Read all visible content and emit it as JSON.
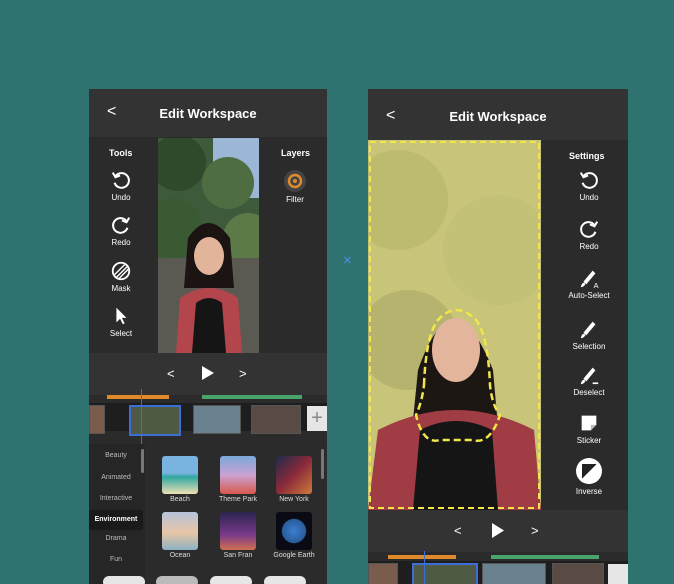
{
  "left_screen": {
    "title": "Edit Workspace",
    "back_glyph": "<",
    "tools_header": "Tools",
    "layers_header": "Layers",
    "tools": [
      {
        "label": "Undo",
        "icon": "undo-icon"
      },
      {
        "label": "Redo",
        "icon": "redo-icon"
      },
      {
        "label": "Mask",
        "icon": "mask-icon"
      },
      {
        "label": "Select",
        "icon": "cursor-icon"
      }
    ],
    "layer": {
      "label": "Filter",
      "icon": "filter-icon"
    },
    "playback": {
      "prev": "<",
      "next": ">"
    },
    "categories": [
      "Beauty",
      "Animated",
      "Interactive",
      "Environment",
      "Drama",
      "Fun"
    ],
    "selected_category": "Environment",
    "filters": [
      "Beach",
      "Theme Park",
      "New York",
      "Ocean",
      "San Fran",
      "Google Earth"
    ],
    "add_glyph": "+"
  },
  "right_screen": {
    "title": "Edit Workspace",
    "back_glyph": "<",
    "settings_header": "Settings",
    "tools": [
      {
        "label": "Undo",
        "icon": "undo-icon"
      },
      {
        "label": "Redo",
        "icon": "redo-icon"
      },
      {
        "label": "Auto-Select",
        "icon": "auto-select-brush-icon"
      },
      {
        "label": "Selection",
        "icon": "brush-icon"
      },
      {
        "label": "Deselect",
        "icon": "deselect-brush-icon"
      },
      {
        "label": "Sticker",
        "icon": "sticker-icon"
      },
      {
        "label": "Inverse",
        "icon": "inverse-icon"
      }
    ],
    "playback": {
      "prev": "<",
      "next": ">"
    }
  },
  "divider_glyph": "×",
  "colors": {
    "background": "#2f7371",
    "accent_blue": "#3b6fd6",
    "orange": "#e08a2c",
    "green": "#4aa36a",
    "selection_yellow": "#e9e27a"
  }
}
